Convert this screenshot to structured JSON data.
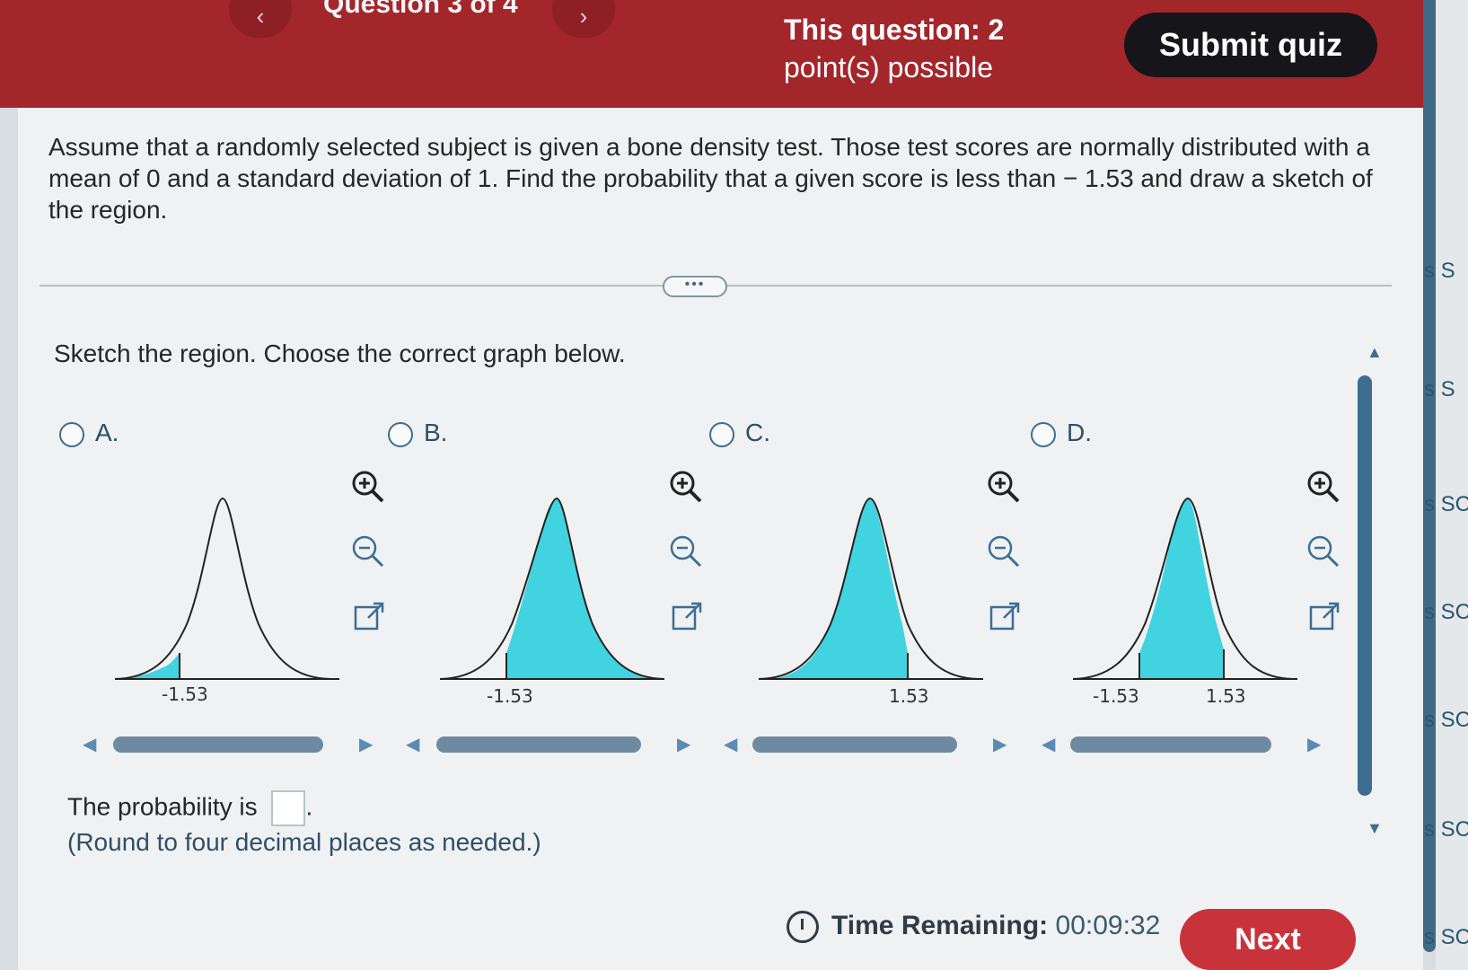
{
  "header": {
    "prev_label": "‹",
    "question_label": "Question 3 of 4",
    "next_label": "›",
    "points_line1": "This question: 2",
    "points_line2": "point(s) possible",
    "submit_label": "Submit quiz"
  },
  "question": {
    "text": "Assume that a randomly selected subject is given a bone density test. Those test scores are normally distributed with a mean of 0 and a standard deviation of 1. Find the probability that a given score is less than − 1.53 and draw a sketch of the region."
  },
  "divider_handle": "•••",
  "instruction": "Sketch the region. Choose the correct graph below.",
  "options": [
    {
      "letter": "A.",
      "labels": [
        "-1.53"
      ],
      "shade": "left-tail"
    },
    {
      "letter": "B.",
      "labels": [
        "-1.53"
      ],
      "shade": "right-of"
    },
    {
      "letter": "C.",
      "labels": [
        "1.53"
      ],
      "shade": "left-of"
    },
    {
      "letter": "D.",
      "labels": [
        "-1.53",
        "1.53"
      ],
      "shade": "between"
    }
  ],
  "icons": [
    "zoom-in-icon",
    "zoom-out-icon",
    "open-new-window-icon"
  ],
  "answer": {
    "prefix": "The probability is",
    "suffix": ".",
    "note": "(Round to four decimal places as needed.)"
  },
  "timer": {
    "label": "Time Remaining:",
    "value": "00:09:32"
  },
  "next_label": "Next",
  "side_fragments": [
    "s S",
    "s S",
    "s SC",
    "s SC",
    "s SC",
    "s SC",
    "s SC"
  ],
  "colors": {
    "header": "#a3262b",
    "shade": "#42d3e0",
    "accent": "#3b6e96",
    "next": "#c8333b"
  }
}
